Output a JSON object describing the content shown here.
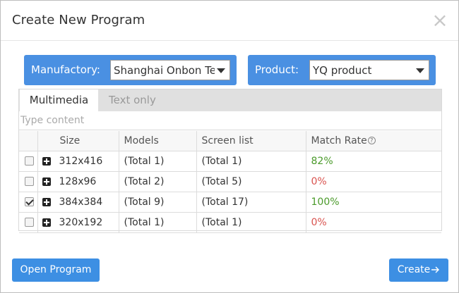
{
  "dialog": {
    "title": "Create New Program",
    "close_glyph": "×"
  },
  "filters": {
    "manufactory": {
      "label": "Manufactory:",
      "value": "Shanghai Onbon Te"
    },
    "product": {
      "label": "Product:",
      "value": "YQ product"
    }
  },
  "tabs": [
    {
      "label": "Multimedia",
      "active": true
    },
    {
      "label": "Text only",
      "active": false
    }
  ],
  "search": {
    "placeholder": "Type content",
    "value": ""
  },
  "table": {
    "headers": {
      "size": "Size",
      "models": "Models",
      "screen_list": "Screen list",
      "match_rate": "Match Rate"
    },
    "rows": [
      {
        "checked": false,
        "size": "312x416",
        "models": "(Total 1)",
        "screen_list": "(Total 1)",
        "match_rate": "82%"
      },
      {
        "checked": false,
        "size": "128x96",
        "models": "(Total 2)",
        "screen_list": "(Total 5)",
        "match_rate": "0%"
      },
      {
        "checked": true,
        "size": "384x384",
        "models": "(Total 9)",
        "screen_list": "(Total 17)",
        "match_rate": "100%"
      },
      {
        "checked": false,
        "size": "320x192",
        "models": "(Total 1)",
        "screen_list": "(Total 1)",
        "match_rate": "0%"
      }
    ]
  },
  "footer": {
    "open_label": "Open Program",
    "create_label": "Create"
  },
  "icons": {
    "close": "close-icon",
    "expand": "plus-square-icon",
    "help": "question-circle-icon",
    "arrow": "arrow-right-icon",
    "caret": "caret-down-icon"
  },
  "colors": {
    "accent": "#4a90e2",
    "button": "#3d8fe3",
    "rate_good": "#4a9a2a",
    "rate_bad": "#d9534f"
  }
}
